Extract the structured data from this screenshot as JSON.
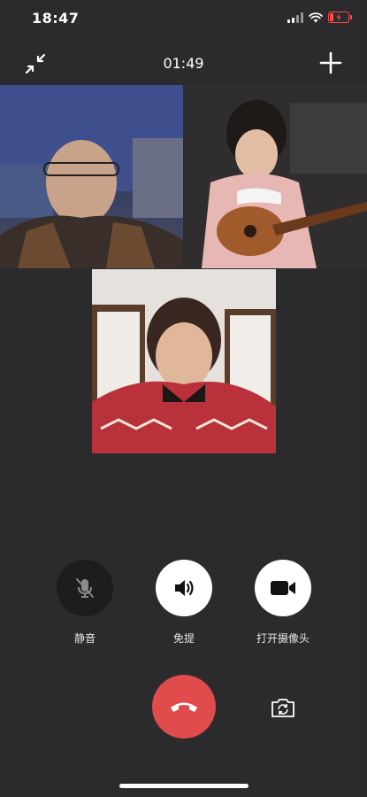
{
  "status_bar": {
    "time": "18:47",
    "battery_color": "#ff4d4d"
  },
  "call": {
    "timer": "01:49"
  },
  "participants": [
    {
      "name": "participant-1-video"
    },
    {
      "name": "participant-2-video"
    },
    {
      "name": "participant-3-video"
    }
  ],
  "controls": {
    "mute_label": "静音",
    "speaker_label": "免提",
    "camera_label": "打开摄像头"
  },
  "icons": {
    "minimize": "minimize-arrows-icon",
    "add": "plus-icon",
    "mute": "microphone-off-icon",
    "speaker": "speaker-icon",
    "camera": "video-camera-icon",
    "hangup": "phone-hangup-icon",
    "flip": "camera-switch-icon"
  },
  "colors": {
    "hangup": "#e04b4b",
    "background": "#2b2b2e"
  }
}
